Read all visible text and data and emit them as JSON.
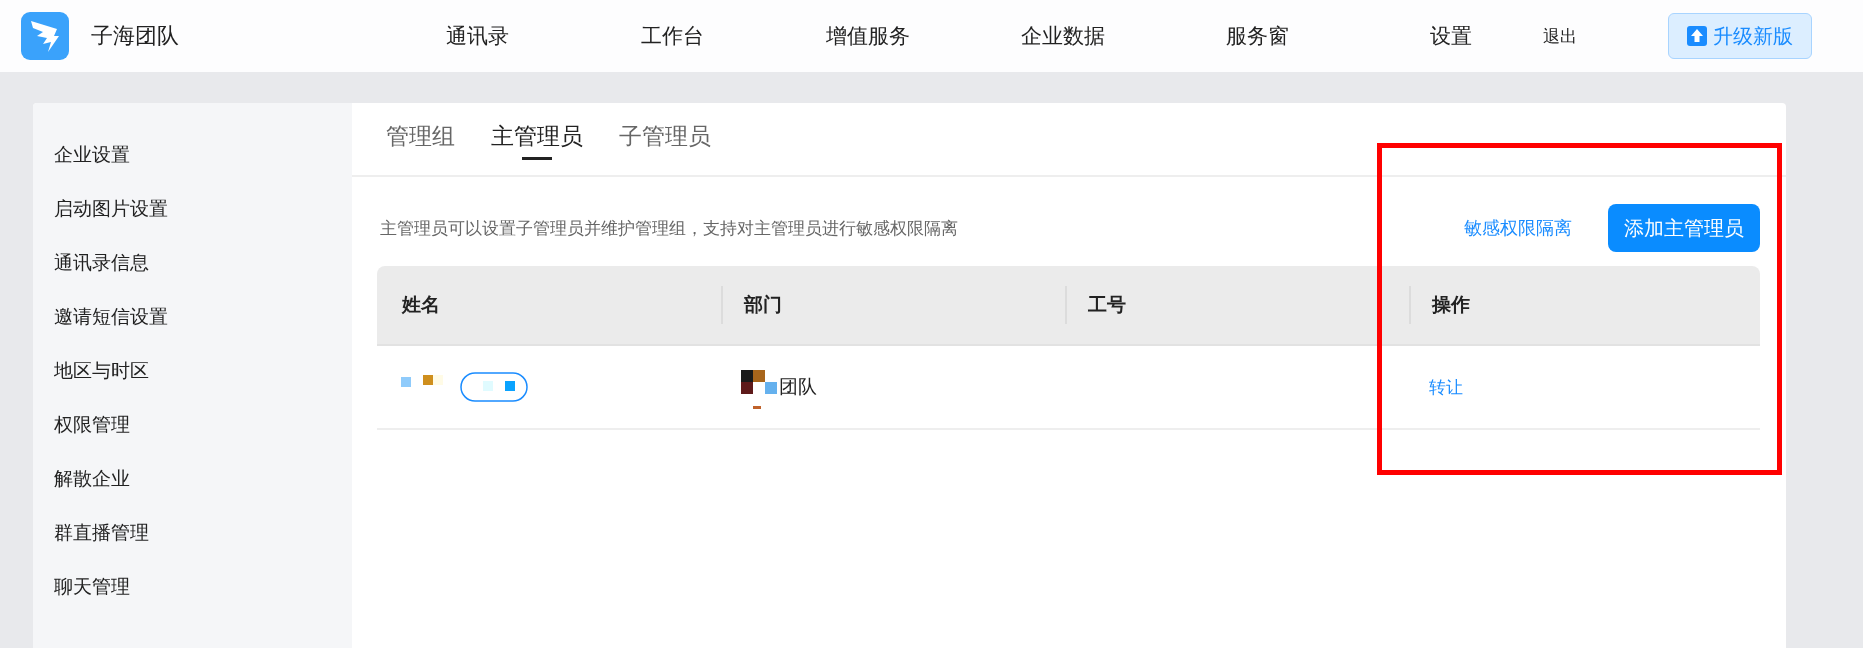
{
  "header": {
    "org_name": "子海团队",
    "nav": [
      {
        "label": "通讯录"
      },
      {
        "label": "工作台"
      },
      {
        "label": "增值服务"
      },
      {
        "label": "企业数据"
      },
      {
        "label": "服务窗"
      }
    ],
    "settings": "设置",
    "logout": "退出",
    "upgrade_button": "升级新版"
  },
  "sidebar": {
    "items": [
      {
        "label": "企业设置"
      },
      {
        "label": "启动图片设置"
      },
      {
        "label": "通讯录信息"
      },
      {
        "label": "邀请短信设置"
      },
      {
        "label": "地区与时区"
      },
      {
        "label": "权限管理"
      },
      {
        "label": "解散企业"
      },
      {
        "label": "群直播管理"
      },
      {
        "label": "聊天管理"
      }
    ]
  },
  "tabs": [
    {
      "label": "管理组",
      "selected": false
    },
    {
      "label": "主管理员",
      "selected": true
    },
    {
      "label": "子管理员",
      "selected": false
    }
  ],
  "description": "主管理员可以设置子管理员并维护管理组，支持对主管理员进行敏感权限隔离",
  "isolation_link": "敏感权限隔离",
  "add_button": "添加主管理员",
  "table": {
    "columns": [
      "姓名",
      "部门",
      "工号",
      "操作"
    ],
    "rows": [
      {
        "name": {
          "kind": "redacted"
        },
        "department": "团队",
        "employee_id": "",
        "action": "转让"
      }
    ]
  },
  "annotations": [
    {
      "kind": "rectangle"
    }
  ]
}
